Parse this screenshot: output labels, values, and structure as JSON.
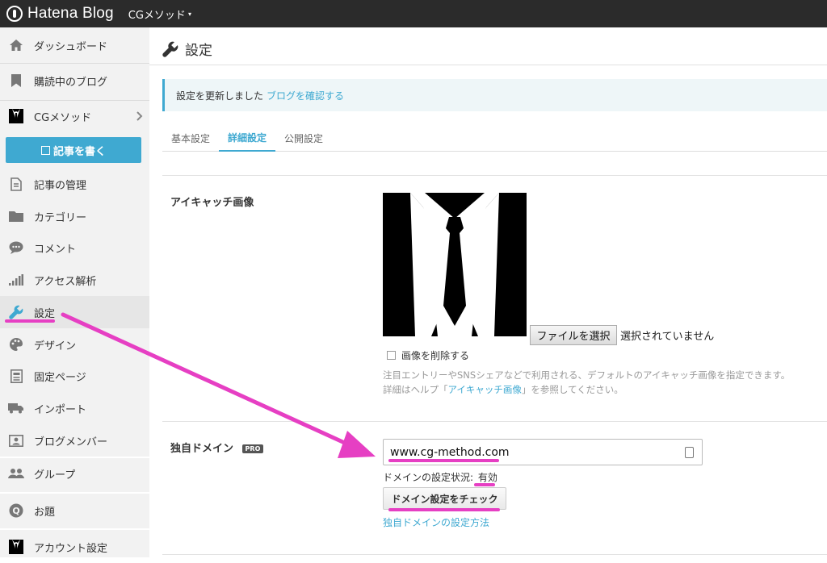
{
  "topbar": {
    "brand": "Hatena Blog",
    "blog_name": "CGメソッド",
    "caret": "▾"
  },
  "sidebar": {
    "items": [
      {
        "label": "ダッシュボード",
        "icon": "home-icon"
      },
      {
        "label": "購読中のブログ",
        "icon": "bookmark-icon"
      },
      {
        "label": "CGメソッド",
        "icon": "blog-avatar-icon"
      },
      {
        "label": "記事の管理",
        "icon": "document-icon"
      },
      {
        "label": "カテゴリー",
        "icon": "folder-icon"
      },
      {
        "label": "コメント",
        "icon": "comment-icon"
      },
      {
        "label": "アクセス解析",
        "icon": "bar-chart-icon"
      },
      {
        "label": "設定",
        "icon": "wrench-icon"
      },
      {
        "label": "デザイン",
        "icon": "palette-icon"
      },
      {
        "label": "固定ページ",
        "icon": "page-icon"
      },
      {
        "label": "インポート",
        "icon": "truck-icon"
      },
      {
        "label": "ブログメンバー",
        "icon": "member-card-icon"
      },
      {
        "label": "グループ",
        "icon": "group-icon"
      },
      {
        "label": "お題",
        "icon": "topic-icon"
      },
      {
        "label": "アカウント設定",
        "icon": "account-avatar-icon"
      }
    ],
    "write_button": "記事を書く",
    "accent": "#3fa9d1",
    "highlight": "#e63fc3"
  },
  "main": {
    "title": "設定",
    "notice": {
      "text": "設定を更新しました",
      "link": "ブログを確認する"
    },
    "tabs": [
      {
        "label": "基本設定",
        "active": false
      },
      {
        "label": "詳細設定",
        "active": true
      },
      {
        "label": "公開設定",
        "active": false
      }
    ],
    "eyecatch": {
      "label": "アイキャッチ画像",
      "file_button": "ファイルを選択",
      "file_status": "選択されていません",
      "delete_checkbox": "画像を削除する",
      "help_line1": "注目エントリーやSNSシェアなどで利用される、デフォルトのアイキャッチ画像を指定できます。",
      "help_line2_pre": "詳細はヘルプ「",
      "help_line2_link": "アイキャッチ画像",
      "help_line2_post": "」を参照してください。"
    },
    "domain": {
      "label": "独自ドメイン",
      "badge": "PRO",
      "value": "www.cg-method.com",
      "status_label": "ドメインの設定状況:",
      "status_value": "有効",
      "check_button": "ドメイン設定をチェック",
      "help_link": "独自ドメインの設定方法"
    }
  }
}
